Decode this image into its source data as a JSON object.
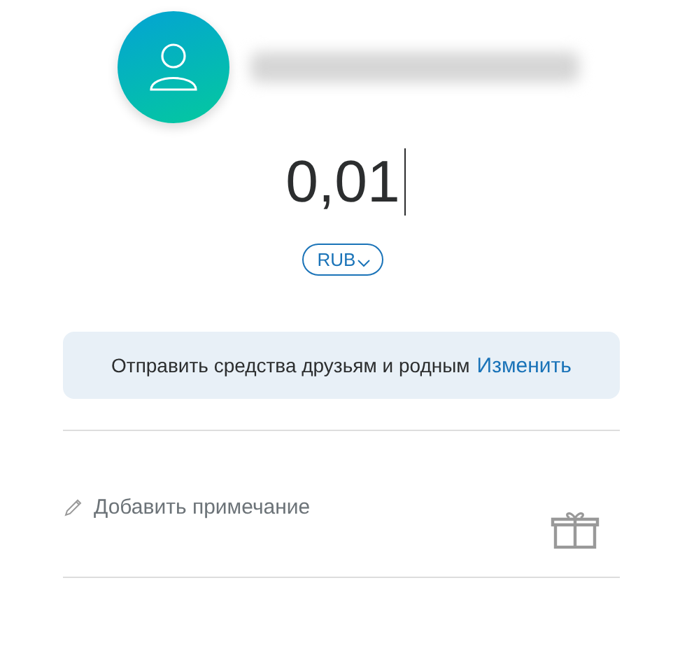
{
  "recipient": {
    "email_redacted": true
  },
  "amount": {
    "value": "0,01",
    "currency": "RUB"
  },
  "info": {
    "text": "Отправить средства друзьям и родным",
    "link": "Изменить"
  },
  "note": {
    "placeholder": "Добавить примечание"
  }
}
